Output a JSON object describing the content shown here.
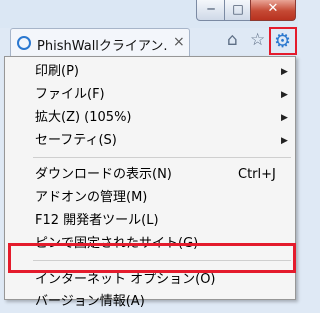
{
  "window": {
    "minimize_glyph": "─",
    "maximize_glyph": "□",
    "close_glyph": "✕"
  },
  "tab": {
    "title": "PhishWallクライアン...",
    "close_glyph": "×"
  },
  "toolbar": {
    "home_glyph": "⌂",
    "star_glyph": "☆",
    "gear_glyph": "⚙"
  },
  "menu": {
    "items": [
      {
        "label": "印刷(P)",
        "shortcut": "",
        "submenu": true
      },
      {
        "label": "ファイル(F)",
        "shortcut": "",
        "submenu": true
      },
      {
        "label": "拡大(Z) (105%)",
        "shortcut": "",
        "submenu": true
      },
      {
        "label": "セーフティ(S)",
        "shortcut": "",
        "submenu": true
      },
      {
        "label": "ダウンロードの表示(N)",
        "shortcut": "Ctrl+J",
        "submenu": false
      },
      {
        "label": "アドオンの管理(M)",
        "shortcut": "",
        "submenu": false
      },
      {
        "label": "F12 開発者ツール(L)",
        "shortcut": "",
        "submenu": false
      },
      {
        "label": "ピンで固定されたサイト(G)",
        "shortcut": "",
        "submenu": false
      },
      {
        "label": "インターネット オプション(O)",
        "shortcut": "",
        "submenu": false
      },
      {
        "label": "バージョン情報(A)",
        "shortcut": "",
        "submenu": false
      }
    ],
    "arrow_glyph": "▶",
    "highlighted_item": "インターネット オプション(O)"
  },
  "colors": {
    "highlight_border": "#e41b2c",
    "accent": "#2b79cf"
  }
}
